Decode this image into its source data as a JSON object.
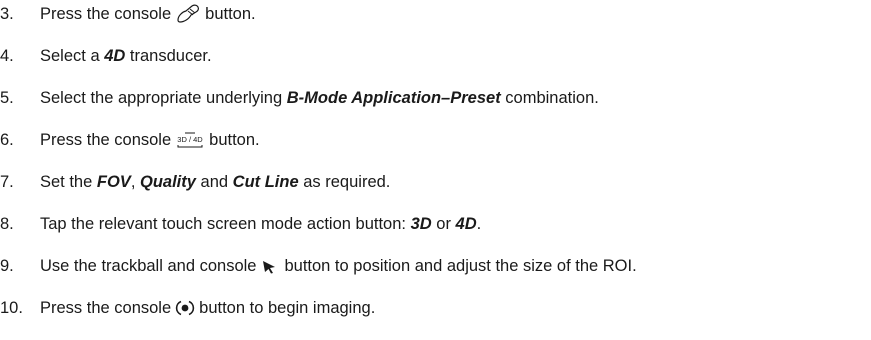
{
  "steps": [
    {
      "number": "3.",
      "parts": {
        "a": "Press the console",
        "b": "button."
      },
      "icon": "transducer-probe-icon"
    },
    {
      "number": "4.",
      "parts": {
        "a": "Select a",
        "b": "4D",
        "c": "transducer."
      }
    },
    {
      "number": "5.",
      "parts": {
        "a": "Select the appropriate underlying",
        "b": "B-Mode Application–Preset",
        "c": "combination."
      }
    },
    {
      "number": "6.",
      "parts": {
        "a": "Press the console",
        "b": "button."
      },
      "icon": "3d-4d-icon",
      "icon_text": "3D / 4D"
    },
    {
      "number": "7.",
      "parts": {
        "a": "Set the",
        "b": "FOV",
        "c": ",",
        "d": "Quality",
        "e": "and",
        "f": "Cut Line",
        "g": "as required."
      }
    },
    {
      "number": "8.",
      "parts": {
        "a": "Tap the relevant touch screen mode action button:",
        "b": "3D",
        "c": "or",
        "d": "4D",
        "e": "."
      }
    },
    {
      "number": "9.",
      "parts": {
        "a": "Use the trackball and console",
        "b": "button to position and adjust the size of the ROI."
      },
      "icon": "arrow-pointer-icon"
    },
    {
      "number": "10.",
      "parts": {
        "a": "Press the console",
        "b": "button to begin imaging."
      },
      "icon": "freeze-toggle-icon"
    }
  ]
}
